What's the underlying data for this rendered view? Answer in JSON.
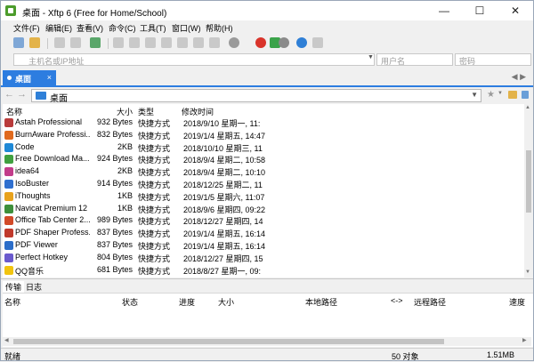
{
  "window": {
    "title": "桌面 - Xftp 6 (Free for Home/School)",
    "minimize": "—",
    "maximize": "☐",
    "close": "✕"
  },
  "menu": [
    "文件(F)",
    "编辑(E)",
    "查看(V)",
    "命令(C)",
    "工具(T)",
    "窗口(W)",
    "帮助(H)"
  ],
  "address": {
    "host_placeholder": "主机名或IP地址",
    "user_placeholder": "用户名",
    "password_placeholder": "密码"
  },
  "tab": {
    "label": "桌面",
    "close": "×",
    "nav_arrows": "◀ ▶"
  },
  "path": {
    "back": "←",
    "forward": "→",
    "current": "桌面"
  },
  "columns": {
    "name": "名称",
    "size": "大小",
    "type": "类型",
    "modified": "修改时间"
  },
  "files": [
    {
      "name": "Astah Professional",
      "size": "932 Bytes",
      "type": "快捷方式",
      "modified": "2018/9/10 星期一, 11:",
      "color": "#b93b3b"
    },
    {
      "name": "BurnAware Professi...",
      "size": "832 Bytes",
      "type": "快捷方式",
      "modified": "2019/1/4 星期五, 14:47",
      "color": "#e06a1e"
    },
    {
      "name": "Code",
      "size": "2KB",
      "type": "快捷方式",
      "modified": "2018/10/10 星期三, 11",
      "color": "#1e88d6"
    },
    {
      "name": "Free Download Ma...",
      "size": "924 Bytes",
      "type": "快捷方式",
      "modified": "2018/9/4 星期二, 10:58",
      "color": "#3fa03f"
    },
    {
      "name": "idea64",
      "size": "2KB",
      "type": "快捷方式",
      "modified": "2018/9/4 星期二, 10:10",
      "color": "#c23c8a"
    },
    {
      "name": "IsoBuster",
      "size": "914 Bytes",
      "type": "快捷方式",
      "modified": "2018/12/25 星期二, 11",
      "color": "#2f6fcf"
    },
    {
      "name": "iThoughts",
      "size": "1KB",
      "type": "快捷方式",
      "modified": "2019/1/5 星期六, 11:07",
      "color": "#e8a21c"
    },
    {
      "name": "Navicat Premium 12",
      "size": "1KB",
      "type": "快捷方式",
      "modified": "2018/9/6 星期四, 09:22",
      "color": "#3d8f3a"
    },
    {
      "name": "Office Tab Center 2...",
      "size": "989 Bytes",
      "type": "快捷方式",
      "modified": "2018/12/27 星期四, 14",
      "color": "#d24a28"
    },
    {
      "name": "PDF Shaper Profess...",
      "size": "837 Bytes",
      "type": "快捷方式",
      "modified": "2019/1/4 星期五, 16:14",
      "color": "#c0392b"
    },
    {
      "name": "PDF Viewer",
      "size": "837 Bytes",
      "type": "快捷方式",
      "modified": "2019/1/4 星期五, 16:14",
      "color": "#2b6dc9"
    },
    {
      "name": "Perfect Hotkey",
      "size": "804 Bytes",
      "type": "快捷方式",
      "modified": "2018/12/27 星期四, 15",
      "color": "#6a5acd"
    },
    {
      "name": "QQ音乐",
      "size": "681 Bytes",
      "type": "快捷方式",
      "modified": "2018/8/27 星期一, 09:",
      "color": "#f1c40f"
    }
  ],
  "bottom_tabs": [
    "传输",
    "日志"
  ],
  "transfer_columns": [
    "名称",
    "状态",
    "进度",
    "大小",
    "本地路径",
    "<->",
    "远程路径",
    "速度"
  ],
  "status": {
    "left": "就绪",
    "count": "50 对象",
    "size": "1.51MB"
  }
}
